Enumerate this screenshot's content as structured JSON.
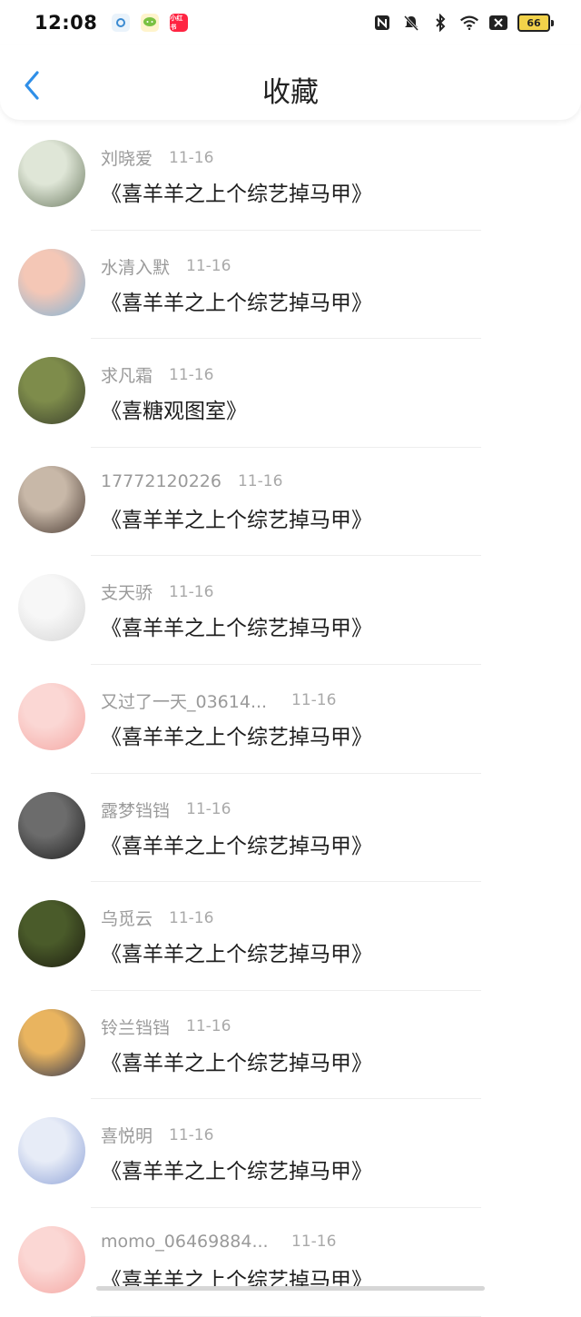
{
  "status_bar": {
    "time": "12:08",
    "battery": "66",
    "app_icons": [
      "gear-app-icon",
      "chat-app-icon",
      "xiaohongshu-app-icon"
    ],
    "xiaohongshu_label": "小红书"
  },
  "header": {
    "title": "收藏"
  },
  "items": [
    {
      "name": "刘晓爱",
      "date": "11-16",
      "title": "《喜羊羊之上个综艺掉马甲》",
      "avatar_colors": [
        "#dfe6d7",
        "#6d7b62"
      ]
    },
    {
      "name": "水清入默",
      "date": "11-16",
      "title": "《喜羊羊之上个综艺掉马甲》",
      "avatar_colors": [
        "#f4c7b6",
        "#7fb3d6"
      ]
    },
    {
      "name": "求凡霜",
      "date": "11-16",
      "title": "《喜糖观图室》",
      "avatar_colors": [
        "#7e8c4b",
        "#3a3f2c"
      ]
    },
    {
      "name": "17772120226",
      "date": "11-16",
      "title": "《喜羊羊之上个综艺掉马甲》",
      "avatar_colors": [
        "#c8b8a8",
        "#4a3b33"
      ]
    },
    {
      "name": "支天骄",
      "date": "11-16",
      "title": "《喜羊羊之上个综艺掉马甲》",
      "avatar_colors": [
        "#f7f7f7",
        "#d5d5d5"
      ]
    },
    {
      "name": "又过了一天_03614...",
      "date": "11-16",
      "title": "《喜羊羊之上个综艺掉马甲》",
      "avatar_colors": [
        "#fbd7d4",
        "#f4a7a3"
      ]
    },
    {
      "name": "露梦铛铛",
      "date": "11-16",
      "title": "《喜羊羊之上个综艺掉马甲》",
      "avatar_colors": [
        "#6c6c6c",
        "#1f1f1f"
      ]
    },
    {
      "name": "乌觅云",
      "date": "11-16",
      "title": "《喜羊羊之上个综艺掉马甲》",
      "avatar_colors": [
        "#4a5b2a",
        "#1d1d10"
      ]
    },
    {
      "name": "铃兰铛铛",
      "date": "11-16",
      "title": "《喜羊羊之上个综艺掉马甲》",
      "avatar_colors": [
        "#e9b45f",
        "#2b3352"
      ]
    },
    {
      "name": "喜悦明",
      "date": "11-16",
      "title": "《喜羊羊之上个综艺掉马甲》",
      "avatar_colors": [
        "#e7ecf7",
        "#8fa3d8"
      ]
    },
    {
      "name": "momo_06469884...",
      "date": "11-16",
      "title": "《喜羊羊之上个综艺掉马甲》",
      "avatar_colors": [
        "#fbd7d4",
        "#f4a7a3"
      ]
    }
  ]
}
